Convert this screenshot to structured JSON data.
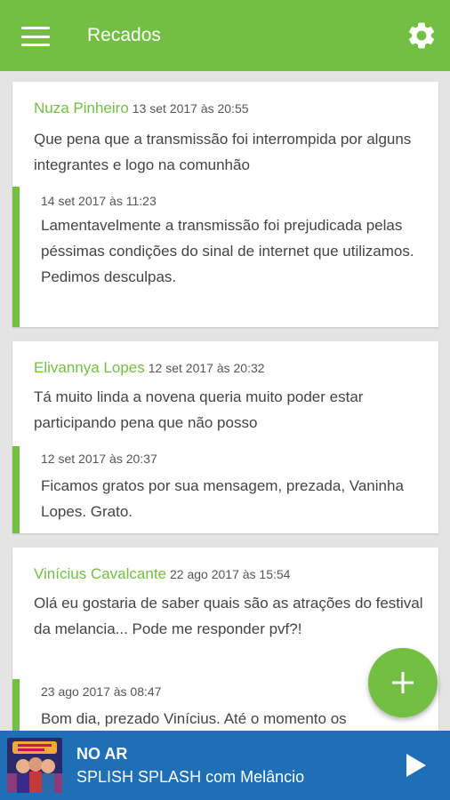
{
  "app": {
    "title": "Recados",
    "menu_icon": "hamburger-menu-icon",
    "settings_icon": "gear-icon",
    "accent": "#72bf44",
    "player_color": "#1e6fb5"
  },
  "messages": [
    {
      "author": "Nuza Pinheiro",
      "date": "13 set 2017 às 20:55",
      "text": "Que  pena que a transmissão foi interrompida por alguns integrantes e  logo na comunhão",
      "reply_date": "14 set 2017 às 11:23",
      "reply_text": "Lamentavelmente a transmissão foi prejudicada pelas péssimas condições do sinal de internet que utilizamos. Pedimos desculpas."
    },
    {
      "author": "Elivannya Lopes",
      "date": "12 set 2017 às 20:32",
      "text": "Tá muito linda a novena queria muito poder estar participando pena que não posso",
      "reply_date": "12 set 2017 às 20:37",
      "reply_text": "Ficamos gratos por sua mensagem, prezada, Vaninha Lopes. Grato."
    },
    {
      "author": "Vinícius Cavalcante",
      "date": "22 ago 2017 às 15:54",
      "text": "Olá eu gostaria de saber quais são as atrações do festival da melancia... Pode me responder pvf?!",
      "reply_date": "23 ago 2017 às 08:47",
      "reply_text": "Bom dia, prezado Vinícius. Até o momento os"
    }
  ],
  "fab": {
    "icon": "plus-icon"
  },
  "player": {
    "status": "NO AR",
    "track": "SPLISH SPLASH com Melâncio",
    "cover_icon": "album-cover-image",
    "play_icon": "play-icon"
  }
}
